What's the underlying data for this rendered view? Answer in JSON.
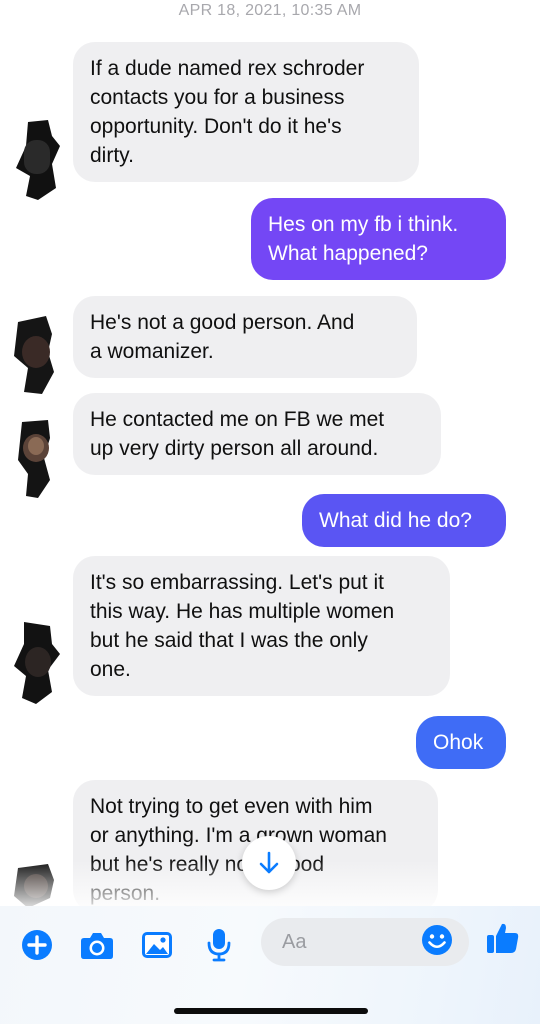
{
  "conversation": {
    "timestamp": "APR 18, 2021, 10:35 AM",
    "messages": [
      {
        "direction": "in",
        "text": "If a dude named rex schroder\ncontacts you for a business\nopportunity. Don't do it he's\ndirty."
      },
      {
        "direction": "out",
        "text": "Hes on my fb i think.\nWhat happened?"
      },
      {
        "direction": "in",
        "text": "He's not a good person.  And\na womanizer."
      },
      {
        "direction": "in",
        "text": "He contacted me on FB we met\nup very dirty person all around."
      },
      {
        "direction": "out",
        "text": "What did he do?"
      },
      {
        "direction": "in",
        "text": "It's so embarrassing. Let's put it\nthis way. He has multiple women\nbut he said that I was the only\none."
      },
      {
        "direction": "out",
        "text": "Ohok"
      },
      {
        "direction": "in",
        "text": "Not trying to get even with him\nor anything. I'm a grown woman\nbut he's really not a good\nperson."
      }
    ]
  },
  "composer": {
    "placeholder": "Aa",
    "icons": [
      "plus-icon",
      "camera-icon",
      "gallery-icon",
      "microphone-icon",
      "emoji-icon",
      "thumbs-up-icon"
    ]
  },
  "colors": {
    "incoming_bubble": "#efeff1",
    "outgoing_top": "#7447f5",
    "outgoing_mid": "#5a55f3",
    "outgoing_bottom": "#3f6cf6",
    "accent": "#0a7cff"
  }
}
